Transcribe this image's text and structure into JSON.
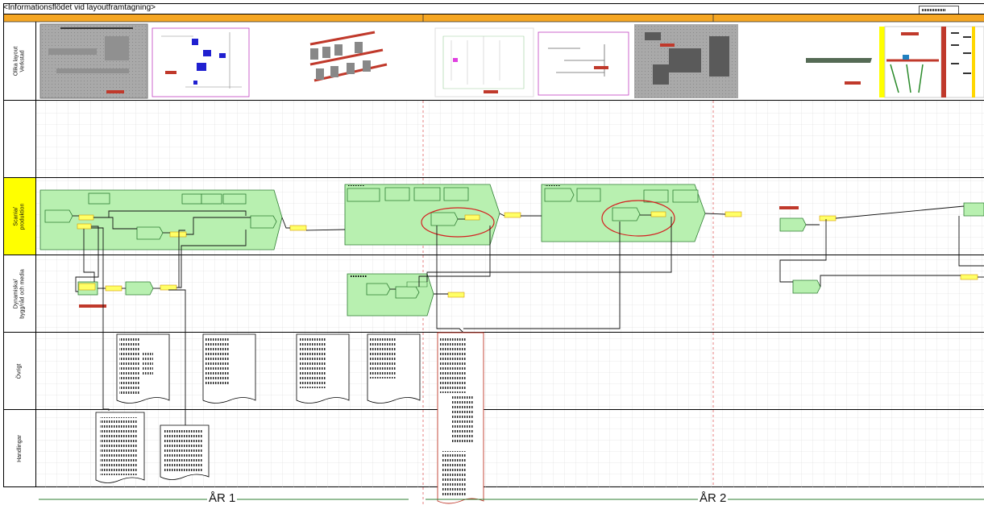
{
  "title": "<Informationsflödet vid layoutframtagning>",
  "lanes": [
    {
      "label": "Olika layout\nVerkstad"
    },
    {
      "label": ""
    },
    {
      "label": "Scania/\nproduktion"
    },
    {
      "label": "Dynamiska/\nbygg/råd och media"
    },
    {
      "label": "Övrigt"
    },
    {
      "label": "Handlingar"
    }
  ],
  "years": [
    "ÅR 1",
    "ÅR 2"
  ],
  "colors": {
    "header_bar": "#f5a623",
    "lane_highlight": "#ffff00",
    "process_fill": "#b8f0b0",
    "process_stroke": "#2e7d32",
    "label_fill": "#ffff66",
    "label_stroke": "#d49b00",
    "divider": "#e06060",
    "grid": "#d8d8d8",
    "ellipse": "#d42020"
  }
}
